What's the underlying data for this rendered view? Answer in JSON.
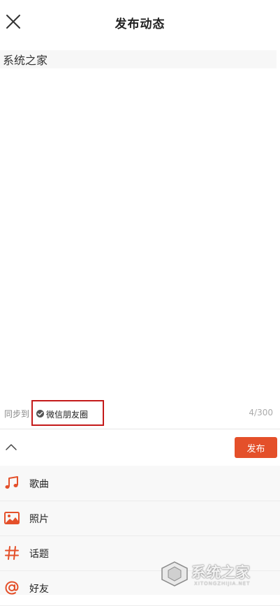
{
  "header": {
    "title": "发布动态",
    "close_icon": "close-icon"
  },
  "editor": {
    "text": "系统之家"
  },
  "sync": {
    "label": "同步到",
    "target_label": "微信朋友圈",
    "char_count": "4/300"
  },
  "toolbar": {
    "collapse_icon": "chevron-up-icon",
    "publish_label": "发布"
  },
  "menu": {
    "items": [
      {
        "label": "歌曲",
        "icon": "music-note-icon"
      },
      {
        "label": "照片",
        "icon": "photo-icon"
      },
      {
        "label": "话题",
        "icon": "hashtag-icon"
      },
      {
        "label": "好友",
        "icon": "at-icon"
      }
    ]
  },
  "colors": {
    "accent": "#e4502a",
    "highlight_box": "#c41a1a"
  },
  "watermark": {
    "text": "系统之家",
    "url": "XITONGZHIJIA.NET"
  }
}
